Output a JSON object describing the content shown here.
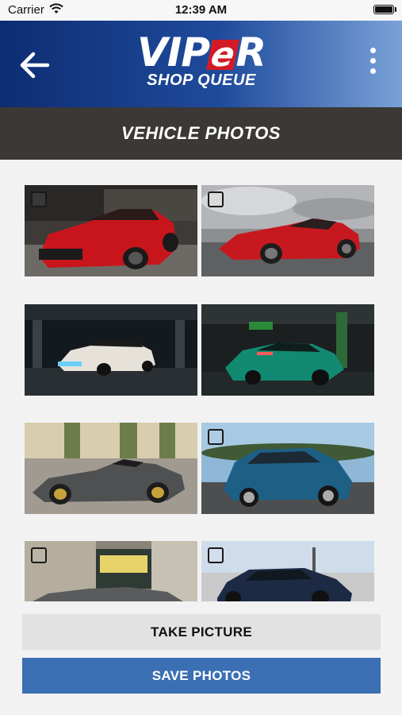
{
  "status_bar": {
    "carrier": "Carrier",
    "time": "12:39 AM"
  },
  "header": {
    "logo_main_prefix": "VIP",
    "logo_main_highlight": "e",
    "logo_main_suffix": "R",
    "logo_sub": "SHOP QUEUE",
    "back_icon": "arrow-left-icon",
    "menu_icon": "more-vertical-icon"
  },
  "page": {
    "title": "VEHICLE PHOTOS"
  },
  "photos": [
    {
      "subject": "red-mustang",
      "selected": false
    },
    {
      "subject": "red-ferrari",
      "selected": false
    },
    {
      "subject": "white-audi-garage",
      "selected": false
    },
    {
      "subject": "green-car-garage",
      "selected": false
    },
    {
      "subject": "grey-ferrari-spider",
      "selected": false
    },
    {
      "subject": "blue-polo",
      "selected": false
    },
    {
      "subject": "grey-sports-car-street",
      "selected": false
    },
    {
      "subject": "dark-blue-sedan",
      "selected": false
    }
  ],
  "actions": {
    "take_picture": "TAKE PICTURE",
    "save_photos": "SAVE PHOTOS"
  },
  "colors": {
    "header_start": "#0d2d73",
    "header_end": "#7aa2d8",
    "title_bar": "#3b3836",
    "save_button": "#3a6fb3",
    "take_button": "#e2e2e2",
    "logo_accent": "#d31b28"
  }
}
